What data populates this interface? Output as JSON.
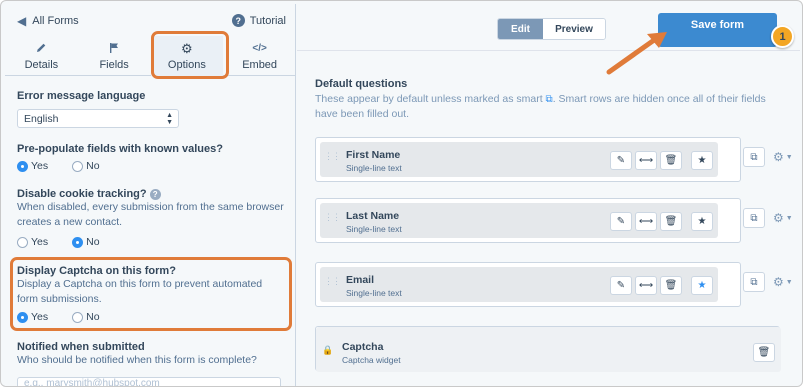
{
  "sidebar": {
    "back_label": "All Forms",
    "tutorial_label": "Tutorial",
    "tabs": [
      {
        "label": "Details",
        "icon": "pencil-icon"
      },
      {
        "label": "Fields",
        "icon": "flag-icon"
      },
      {
        "label": "Options",
        "icon": "gear-icon",
        "active": true
      },
      {
        "label": "Embed",
        "icon": "code-icon"
      }
    ],
    "options": {
      "error_language_label": "Error message language",
      "error_language_value": "English",
      "prepopulate_label": "Pre-populate fields with known values?",
      "prepopulate_yes": "Yes",
      "prepopulate_no": "No",
      "cookie_label": "Disable cookie tracking?",
      "cookie_help": "When disabled, every submission from the same browser creates a new contact.",
      "cookie_yes": "Yes",
      "cookie_no": "No",
      "captcha_label": "Display Captcha on this form?",
      "captcha_help": "Display a Captcha on this form to prevent automated form submissions.",
      "captcha_yes": "Yes",
      "captcha_no": "No",
      "notified_label": "Notified when submitted",
      "notified_help": "Who should be notified when this form is complete?",
      "notified_value": "e.g., marysmith@hubspot.com"
    }
  },
  "main": {
    "edit_label": "Edit",
    "preview_label": "Preview",
    "save_label": "Save form",
    "badge": "1",
    "default_questions_title": "Default questions",
    "default_questions_desc_a": "These appear by default unless marked as smart",
    "default_questions_desc_b": ". Smart rows are hidden once all of their fields have been filled out.",
    "fields": [
      {
        "name": "First Name",
        "type": "Single-line text",
        "required": false
      },
      {
        "name": "Last Name",
        "type": "Single-line text",
        "required": false
      },
      {
        "name": "Email",
        "type": "Single-line text",
        "required": true
      }
    ],
    "captcha": {
      "name": "Captcha",
      "type": "Captcha widget"
    }
  },
  "colors": {
    "accent": "#3c8ad0",
    "highlight": "#e07b39",
    "radio_on": "#2e8ff0",
    "badge": "#f3a624"
  }
}
